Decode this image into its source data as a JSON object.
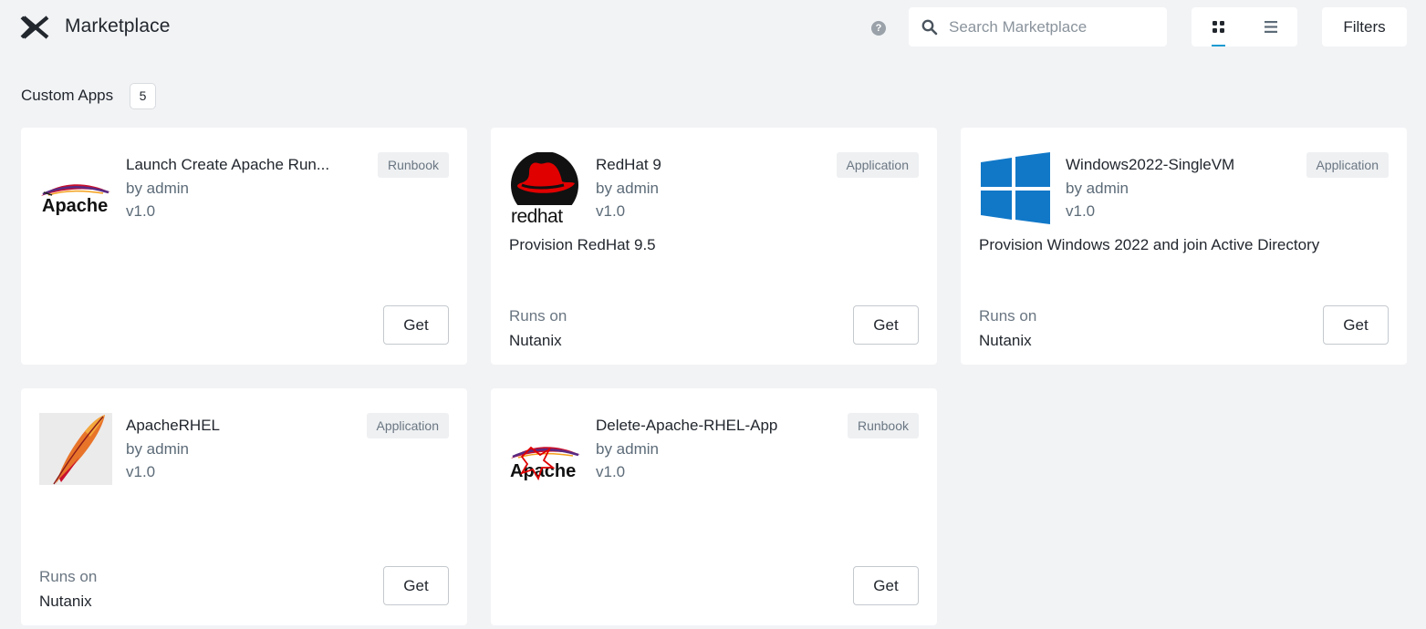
{
  "header": {
    "title": "Marketplace",
    "search_placeholder": "Search Marketplace",
    "filters_label": "Filters"
  },
  "section": {
    "title": "Custom Apps",
    "count": "5"
  },
  "apps": [
    {
      "name": "Launch Create Apache Run...",
      "author": "by admin",
      "version": "v1.0",
      "type": "Runbook",
      "description": "",
      "runs_on_label": "",
      "runs_on": "",
      "get_label": "Get",
      "logo": "apache-feather-logo"
    },
    {
      "name": "RedHat 9",
      "author": "by admin",
      "version": "v1.0",
      "type": "Application",
      "description": "Provision RedHat 9.5",
      "runs_on_label": "Runs on",
      "runs_on": "Nutanix",
      "get_label": "Get",
      "logo": "redhat-logo",
      "logo_text": "redhat"
    },
    {
      "name": "Windows2022-SingleVM",
      "author": "by admin",
      "version": "v1.0",
      "type": "Application",
      "description": "Provision Windows 2022 and join Active Directory",
      "runs_on_label": "Runs on",
      "runs_on": "Nutanix",
      "get_label": "Get",
      "logo": "windows-logo"
    },
    {
      "name": "ApacheRHEL",
      "author": "by admin",
      "version": "v1.0",
      "type": "Application",
      "description": "",
      "runs_on_label": "Runs on",
      "runs_on": "Nutanix",
      "get_label": "Get",
      "logo": "apache-feather-icon"
    },
    {
      "name": "Delete-Apache-RHEL-App",
      "author": "by admin",
      "version": "v1.0",
      "type": "Runbook",
      "description": "",
      "runs_on_label": "",
      "runs_on": "",
      "get_label": "Get",
      "logo": "apache-feather-crossed-logo"
    }
  ],
  "logos": {
    "apache_text": "Apache"
  },
  "colors": {
    "background": "#f2f3f5",
    "card": "#ffffff",
    "accent": "#1b9bd1",
    "windows_blue": "#1178c8",
    "redhat_red": "#e00000"
  }
}
